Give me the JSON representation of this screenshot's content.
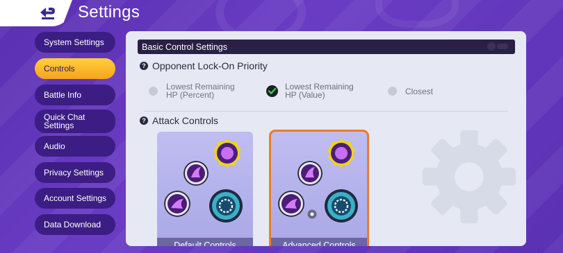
{
  "header": {
    "title": "Settings",
    "back_icon": "back-arrow-icon"
  },
  "sidebar": {
    "items": [
      {
        "label": "System Settings",
        "active": false
      },
      {
        "label": "Controls",
        "active": true
      },
      {
        "label": "Battle Info",
        "active": false
      },
      {
        "label": "Quick Chat Settings",
        "active": false
      },
      {
        "label": "Audio",
        "active": false
      },
      {
        "label": "Privacy Settings",
        "active": false
      },
      {
        "label": "Account Settings",
        "active": false
      },
      {
        "label": "Data Download",
        "active": false
      }
    ]
  },
  "main": {
    "section_title": "Basic Control Settings",
    "lock_on": {
      "label": "Opponent Lock-On Priority",
      "options": [
        {
          "label": "Lowest Remaining HP (Percent)",
          "selected": false
        },
        {
          "label": "Lowest Remaining HP (Value)",
          "selected": true
        },
        {
          "label": "Closest",
          "selected": false
        }
      ]
    },
    "attack_controls": {
      "label": "Attack Controls",
      "cards": [
        {
          "label": "Default Controls",
          "selected": false
        },
        {
          "label": "Advanced Controls",
          "selected": true
        }
      ]
    }
  },
  "colors": {
    "background": "#5a2fb0",
    "sidebar_item": "#3c1d84",
    "active_item": "#ffc32e",
    "panel": "#e6e9f4",
    "section_header": "#2a1f44",
    "selected_outline": "#f07a2a",
    "check_mark": "#35d04a"
  }
}
